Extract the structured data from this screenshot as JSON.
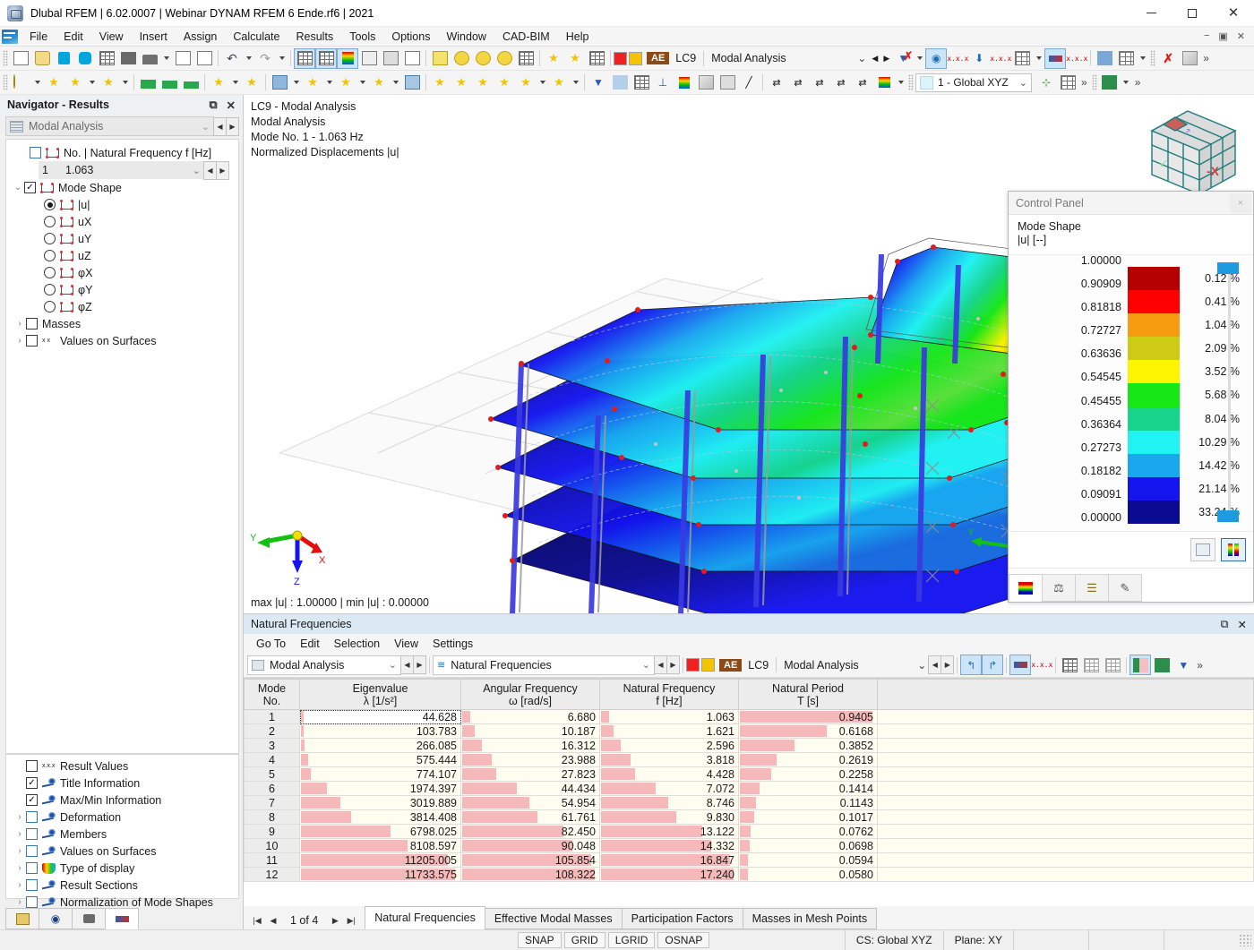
{
  "window": {
    "title": "Dlubal RFEM | 6.02.0007 | Webinar DYNAM RFEM 6 Ende.rf6 | 2021",
    "minimize": "−",
    "maximize": "□",
    "close": "✕"
  },
  "menubar": {
    "items": [
      "File",
      "Edit",
      "View",
      "Insert",
      "Assign",
      "Calculate",
      "Results",
      "Tools",
      "Options",
      "Window",
      "CAD-BIM",
      "Help"
    ],
    "right": [
      "−",
      "▣",
      "✕"
    ]
  },
  "toolbar": {
    "load_case_tag": "AE",
    "load_case": "LC9",
    "load_case_name": "Modal Analysis",
    "coord_system": "1 - Global XYZ"
  },
  "navigator": {
    "title": "Navigator - Results",
    "restore": "⧉",
    "close": "✕",
    "analysis": "Modal Analysis",
    "tree": {
      "freq_label": "No. | Natural Frequency f [Hz]",
      "freq_index": "1",
      "freq_value": "1.063",
      "mode_shape": "Mode Shape",
      "components": [
        "|u|",
        "uX",
        "uY",
        "uZ",
        "φX",
        "φY",
        "φZ"
      ],
      "selected_component": "|u|",
      "masses": "Masses",
      "values_on_surfaces": "Values on Surfaces"
    },
    "display_items": [
      {
        "label": "Result Values",
        "checked": false,
        "expandable": false,
        "icon": "xxx-icon"
      },
      {
        "label": "Title Information",
        "checked": true,
        "expandable": false,
        "icon": "eye-icon"
      },
      {
        "label": "Max/Min Information",
        "checked": true,
        "expandable": false,
        "icon": "eye-icon"
      },
      {
        "label": "Deformation",
        "checked": false,
        "expandable": true,
        "icon": "eye-icon"
      },
      {
        "label": "Members",
        "checked": false,
        "expandable": true,
        "icon": "eye-icon"
      },
      {
        "label": "Values on Surfaces",
        "checked": false,
        "expandable": true,
        "icon": "eye-icon"
      },
      {
        "label": "Type of display",
        "checked": false,
        "expandable": true,
        "icon": "rainbow-icon"
      },
      {
        "label": "Result Sections",
        "checked": false,
        "expandable": true,
        "icon": "eye-icon"
      },
      {
        "label": "Normalization of Mode Shapes",
        "checked": false,
        "expandable": true,
        "icon": "eye-icon"
      }
    ]
  },
  "view": {
    "title_lines": [
      "LC9 - Modal Analysis",
      "Modal Analysis",
      "Mode No. 1 - 1.063 Hz",
      "Normalized Displacements |u|"
    ],
    "minmax": "max |u| : 1.00000 | min |u| : 0.00000",
    "axis_labels": {
      "x": "X",
      "y": "Y",
      "z": "Z"
    },
    "navcube_face": "-X"
  },
  "control_panel": {
    "title": "Control Panel",
    "close": "×",
    "subtitle_line1": "Mode Shape",
    "subtitle_line2": "|u| [--]",
    "scale_values": [
      "1.00000",
      "0.90909",
      "0.81818",
      "0.72727",
      "0.63636",
      "0.54545",
      "0.45455",
      "0.36364",
      "0.27273",
      "0.18182",
      "0.09091",
      "0.00000"
    ],
    "bands": [
      {
        "color": "#b50000",
        "pct": "0.12 %"
      },
      {
        "color": "#fd0000",
        "pct": "0.41 %"
      },
      {
        "color": "#f79c10",
        "pct": "1.04 %"
      },
      {
        "color": "#cdcb15",
        "pct": "2.09 %"
      },
      {
        "color": "#fdf400",
        "pct": "3.52 %"
      },
      {
        "color": "#17e617",
        "pct": "5.68 %"
      },
      {
        "color": "#16d48a",
        "pct": "8.04 %"
      },
      {
        "color": "#21f2f2",
        "pct": "10.29 %"
      },
      {
        "color": "#19a7f0",
        "pct": "14.42 %"
      },
      {
        "color": "#1414ef",
        "pct": "21.14 %"
      },
      {
        "color": "#0a0a93",
        "pct": "33.24 %"
      }
    ],
    "slider_color": "#1e9ae0"
  },
  "table_panel": {
    "title": "Natural Frequencies",
    "restore": "⧉",
    "close": "✕",
    "menu": [
      "Go To",
      "Edit",
      "Selection",
      "View",
      "Settings"
    ],
    "analysis_combo": "Modal Analysis",
    "table_combo": "Natural Frequencies",
    "lc_tag": "AE",
    "lc": "LC9",
    "lc_name": "Modal Analysis",
    "pager": "1 of 4",
    "tabs": [
      "Natural Frequencies",
      "Effective Modal Masses",
      "Participation Factors",
      "Masses in Mesh Points"
    ],
    "selected_tab": "Natural Frequencies"
  },
  "chart_data": {
    "type": "table",
    "title": "Natural Frequencies",
    "columns": [
      {
        "header1": "Mode",
        "header2": "No.",
        "key": "mode"
      },
      {
        "header1": "Eigenvalue",
        "header2": "λ [1/s²]",
        "key": "eigenvalue",
        "max": 11733.575
      },
      {
        "header1": "Angular Frequency",
        "header2": "ω [rad/s]",
        "key": "omega",
        "max": 108.322
      },
      {
        "header1": "Natural Frequency",
        "header2": "f [Hz]",
        "key": "freq",
        "max": 17.24
      },
      {
        "header1": "Natural Period",
        "header2": "T [s]",
        "key": "period",
        "max": 0.9405
      }
    ],
    "rows": [
      {
        "mode": "1",
        "eigenvalue": "44.628",
        "omega": "6.680",
        "freq": "1.063",
        "period": "0.9405"
      },
      {
        "mode": "2",
        "eigenvalue": "103.783",
        "omega": "10.187",
        "freq": "1.621",
        "period": "0.6168"
      },
      {
        "mode": "3",
        "eigenvalue": "266.085",
        "omega": "16.312",
        "freq": "2.596",
        "period": "0.3852"
      },
      {
        "mode": "4",
        "eigenvalue": "575.444",
        "omega": "23.988",
        "freq": "3.818",
        "period": "0.2619"
      },
      {
        "mode": "5",
        "eigenvalue": "774.107",
        "omega": "27.823",
        "freq": "4.428",
        "period": "0.2258"
      },
      {
        "mode": "6",
        "eigenvalue": "1974.397",
        "omega": "44.434",
        "freq": "7.072",
        "period": "0.1414"
      },
      {
        "mode": "7",
        "eigenvalue": "3019.889",
        "omega": "54.954",
        "freq": "8.746",
        "period": "0.1143"
      },
      {
        "mode": "8",
        "eigenvalue": "3814.408",
        "omega": "61.761",
        "freq": "9.830",
        "period": "0.1017"
      },
      {
        "mode": "9",
        "eigenvalue": "6798.025",
        "omega": "82.450",
        "freq": "13.122",
        "period": "0.0762"
      },
      {
        "mode": "10",
        "eigenvalue": "8108.597",
        "omega": "90.048",
        "freq": "14.332",
        "period": "0.0698"
      },
      {
        "mode": "11",
        "eigenvalue": "11205.005",
        "omega": "105.854",
        "freq": "16.847",
        "period": "0.0594"
      },
      {
        "mode": "12",
        "eigenvalue": "11733.575",
        "omega": "108.322",
        "freq": "17.240",
        "period": "0.0580"
      }
    ],
    "selected_row": 1,
    "bar_color": "#f6b8b8"
  },
  "statusbar": {
    "buttons": [
      "SNAP",
      "GRID",
      "LGRID",
      "OSNAP"
    ],
    "cs": "CS: Global XYZ",
    "plane": "Plane: XY"
  }
}
